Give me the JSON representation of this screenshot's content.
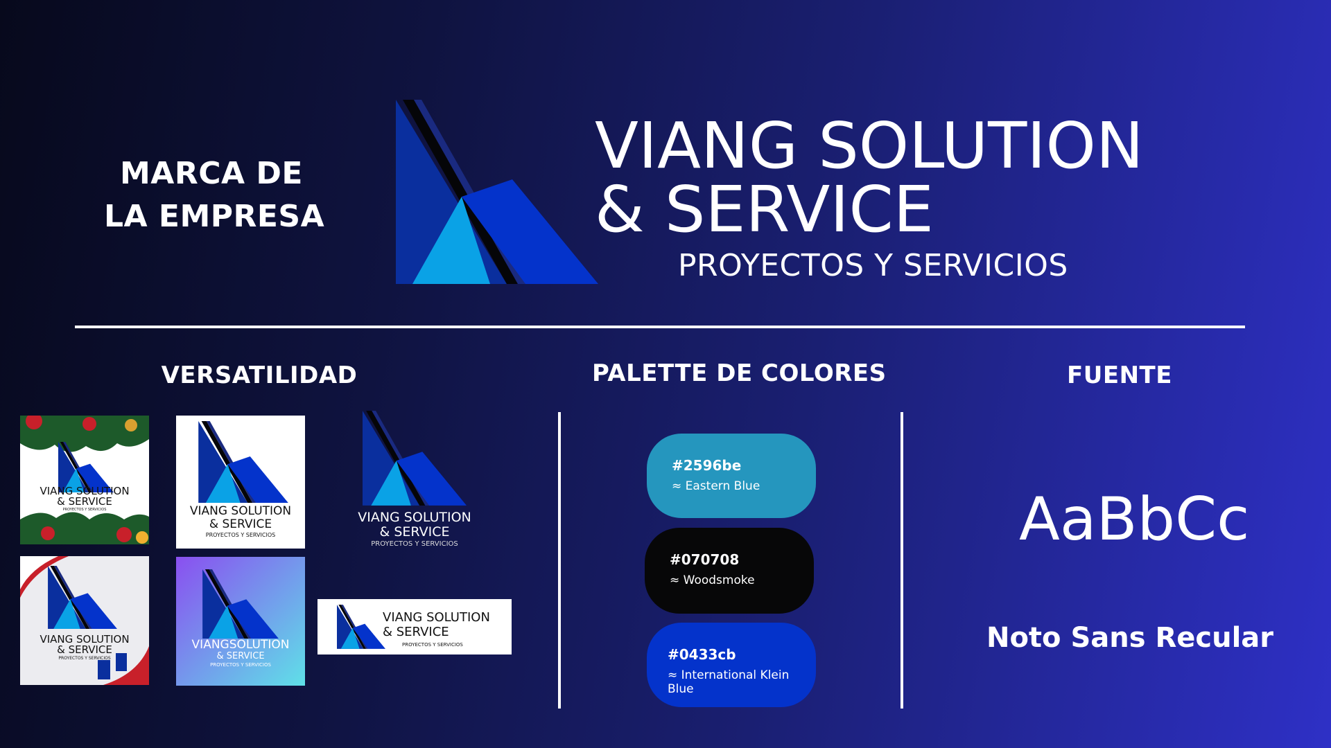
{
  "brand": {
    "heading_line1": "MARCA DE",
    "heading_line2": "LA EMPRESA",
    "title_line1": "VIANG SOLUTION",
    "title_line2": "& SERVICE",
    "tagline": "PROYECTOS Y SERVICIOS"
  },
  "sections": {
    "versatility": "VERSATILIDAD",
    "palette": "PALETTE DE COLORES",
    "font": "FUENTE"
  },
  "logo_variants": {
    "name_line1": "VIANG SOLUTION",
    "name_line2": "& SERVICE",
    "name_compact": "VIANGSOLUTION",
    "tagline": "PROYECTOS Y SERVICIOS"
  },
  "palette": [
    {
      "hex": "#2596be",
      "name": "≈ Eastern Blue",
      "color": "#2596be"
    },
    {
      "hex": "#070708",
      "name": "≈ Woodsmoke",
      "color": "#070708"
    },
    {
      "hex": "#0433cb",
      "name": "≈ International Klein Blue",
      "color": "#0433cb"
    }
  ],
  "font": {
    "sample": "AaBbCc",
    "name": "Noto Sans Recular"
  },
  "colors": {
    "logo_dark_blue": "#0a2f9e",
    "logo_light_blue": "#0aa2e6",
    "logo_royal_blue": "#0433cb",
    "logo_stripe": "#050508"
  }
}
